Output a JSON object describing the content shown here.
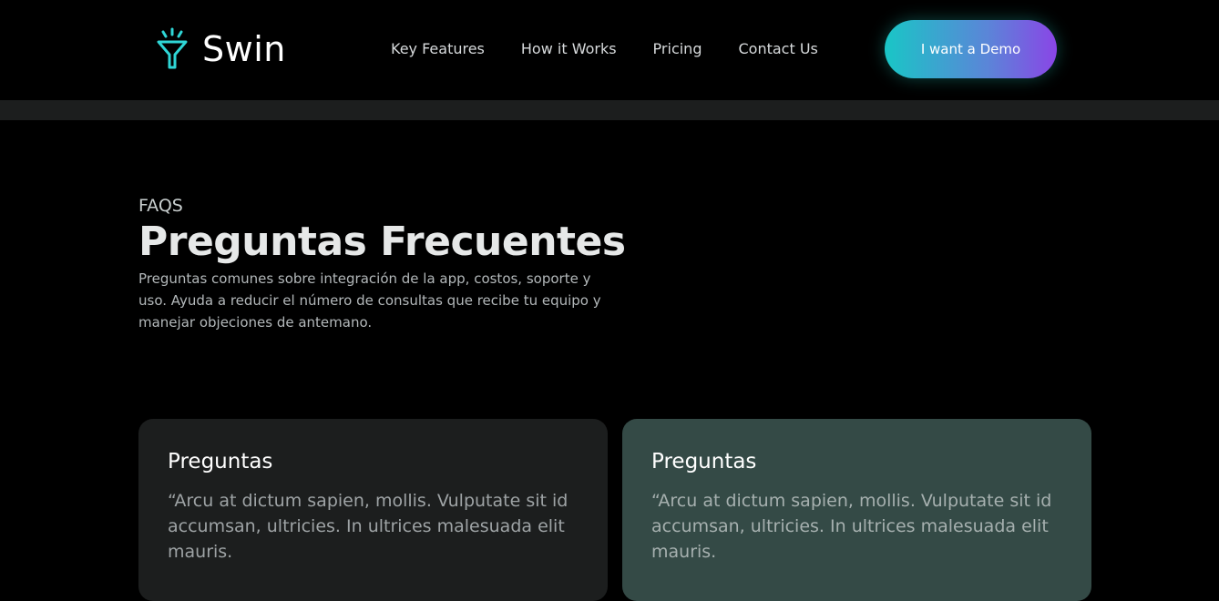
{
  "brand": {
    "name": "Swin",
    "icon": "funnel-sparkle-icon",
    "icon_color": "#2fd6d6"
  },
  "nav": {
    "links": [
      {
        "label": "Key Features"
      },
      {
        "label": "How it Works"
      },
      {
        "label": "Pricing"
      },
      {
        "label": "Contact Us"
      }
    ],
    "cta_label": "I want a Demo",
    "cta_gradient": [
      "#19c6c6",
      "#5b85d8",
      "#8a45e6"
    ]
  },
  "faq": {
    "eyebrow": "FAQS",
    "title": "Preguntas Frecuentes",
    "subtitle": "Preguntas comunes sobre integración de la app, costos, soporte y uso. Ayuda a reducir el número de consultas que recibe tu equipo y manejar objeciones de antemano."
  },
  "cards": [
    {
      "title": "Preguntas",
      "body": "“Arcu at dictum sapien, mollis. Vulputate sit id accumsan, ultricies. In ultrices malesuada elit mauris.",
      "background": "#1c1e1e"
    },
    {
      "title": "Preguntas",
      "body": "“Arcu at dictum sapien, mollis. Vulputate sit id accumsan, ultricies. In ultrices malesuada elit mauris.",
      "background": "#344a46"
    }
  ]
}
